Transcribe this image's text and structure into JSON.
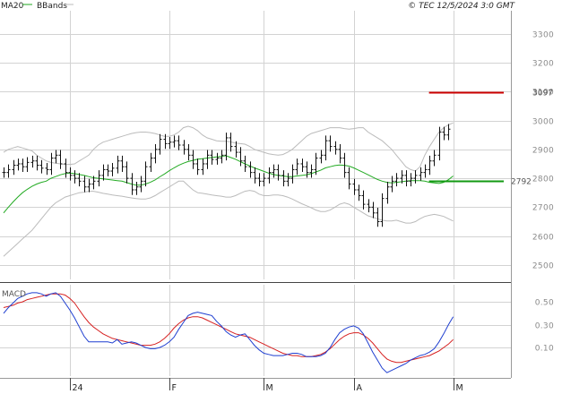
{
  "header": {
    "ma_label": "MA20",
    "bb_label": "BBands",
    "source": "© TEC 12/5/2024 3:0 GMT"
  },
  "colors": {
    "price": "#111111",
    "ma20": "#22aa22",
    "bbands": "#bbbbbb",
    "macd": "#1f3fd0",
    "signal": "#d62020",
    "grid": "#d3d3d3",
    "resistance": "#cc0000",
    "support": "#119911"
  },
  "chart_data": [
    {
      "type": "ohlc",
      "ylim": [
        2450,
        3380
      ],
      "yticks": [
        2500,
        2600,
        2700,
        2800,
        2900,
        3000,
        3100,
        3200,
        3300
      ],
      "ytick_labels": [
        "2500",
        "2600",
        "2700",
        "2800",
        "2900",
        "3000",
        "3100",
        "3200",
        "3300"
      ],
      "x_labels": [
        {
          "bar": 14,
          "label": "24"
        },
        {
          "bar": 35,
          "label": "F"
        },
        {
          "bar": 55,
          "label": "M"
        },
        {
          "bar": 74,
          "label": "A"
        },
        {
          "bar": 95,
          "label": "M"
        }
      ],
      "closes": [
        2820,
        2830,
        2845,
        2850,
        2840,
        2855,
        2860,
        2845,
        2835,
        2830,
        2870,
        2880,
        2850,
        2820,
        2810,
        2800,
        2790,
        2770,
        2780,
        2790,
        2810,
        2830,
        2825,
        2835,
        2860,
        2840,
        2800,
        2760,
        2770,
        2790,
        2840,
        2870,
        2900,
        2935,
        2920,
        2925,
        2930,
        2915,
        2900,
        2880,
        2850,
        2830,
        2850,
        2880,
        2865,
        2870,
        2880,
        2940,
        2910,
        2890,
        2860,
        2840,
        2820,
        2800,
        2790,
        2800,
        2820,
        2830,
        2810,
        2790,
        2800,
        2830,
        2850,
        2840,
        2820,
        2830,
        2870,
        2880,
        2930,
        2910,
        2900,
        2870,
        2820,
        2780,
        2760,
        2740,
        2710,
        2700,
        2680,
        2650,
        2730,
        2770,
        2790,
        2800,
        2810,
        2790,
        2800,
        2810,
        2820,
        2830,
        2860,
        2880,
        2960,
        2950,
        2970
      ],
      "bars": 96,
      "ma20": [
        2680,
        2700,
        2718,
        2735,
        2750,
        2762,
        2772,
        2780,
        2786,
        2790,
        2800,
        2806,
        2812,
        2816,
        2818,
        2816,
        2813,
        2810,
        2806,
        2802,
        2800,
        2798,
        2796,
        2794,
        2792,
        2790,
        2785,
        2780,
        2776,
        2776,
        2780,
        2786,
        2794,
        2805,
        2815,
        2826,
        2836,
        2845,
        2852,
        2858,
        2862,
        2866,
        2868,
        2870,
        2872,
        2874,
        2876,
        2878,
        2872,
        2866,
        2858,
        2850,
        2843,
        2836,
        2830,
        2824,
        2818,
        2813,
        2810,
        2808,
        2806,
        2806,
        2808,
        2810,
        2812,
        2816,
        2822,
        2828,
        2836,
        2840,
        2844,
        2846,
        2845,
        2842,
        2836,
        2828,
        2820,
        2812,
        2804,
        2796,
        2790,
        2786,
        2784,
        2786,
        2788,
        2790,
        2792,
        2792,
        2792,
        2790,
        2786,
        2784,
        2782,
        2786,
        2795,
        2808
      ],
      "bb_upper": [
        2890,
        2900,
        2905,
        2910,
        2905,
        2900,
        2895,
        2880,
        2870,
        2860,
        2855,
        2852,
        2850,
        2848,
        2848,
        2850,
        2860,
        2870,
        2880,
        2900,
        2915,
        2925,
        2930,
        2935,
        2940,
        2945,
        2950,
        2955,
        2958,
        2960,
        2960,
        2958,
        2955,
        2950,
        2945,
        2945,
        2950,
        2960,
        2975,
        2980,
        2975,
        2965,
        2950,
        2940,
        2935,
        2930,
        2928,
        2928,
        2926,
        2922,
        2920,
        2918,
        2910,
        2900,
        2895,
        2890,
        2885,
        2882,
        2880,
        2882,
        2890,
        2900,
        2915,
        2930,
        2945,
        2955,
        2960,
        2965,
        2970,
        2975,
        2975,
        2975,
        2972,
        2970,
        2972,
        2975,
        2975,
        2960,
        2950,
        2940,
        2930,
        2915,
        2900,
        2880,
        2860,
        2840,
        2830,
        2825,
        2840,
        2880,
        2910,
        2935,
        2960,
        2975,
        2985,
        2992
      ],
      "bb_lower": [
        2530,
        2545,
        2560,
        2575,
        2590,
        2605,
        2620,
        2640,
        2660,
        2680,
        2700,
        2715,
        2725,
        2735,
        2740,
        2745,
        2750,
        2752,
        2755,
        2755,
        2752,
        2748,
        2745,
        2742,
        2740,
        2738,
        2735,
        2732,
        2730,
        2728,
        2728,
        2732,
        2740,
        2750,
        2760,
        2770,
        2780,
        2790,
        2790,
        2775,
        2760,
        2750,
        2748,
        2745,
        2742,
        2740,
        2738,
        2735,
        2735,
        2740,
        2748,
        2755,
        2758,
        2755,
        2745,
        2740,
        2740,
        2742,
        2742,
        2740,
        2735,
        2728,
        2720,
        2712,
        2705,
        2698,
        2690,
        2685,
        2685,
        2690,
        2700,
        2710,
        2715,
        2710,
        2700,
        2690,
        2680,
        2670,
        2665,
        2660,
        2655,
        2652,
        2652,
        2655,
        2650,
        2645,
        2645,
        2650,
        2660,
        2668,
        2672,
        2675,
        2672,
        2668,
        2660,
        2652
      ],
      "resistance": {
        "value": 3097,
        "label": "3097",
        "start_bar": 88
      },
      "support": {
        "value": 2792,
        "label": "2792",
        "start_bar": 88
      }
    },
    {
      "type": "line",
      "title": "MACD",
      "ylim": [
        -0.15,
        0.65
      ],
      "yticks": [
        0.1,
        0.3,
        0.5
      ],
      "ytick_labels": [
        "0.10",
        "0.30",
        "0.50"
      ],
      "series": [
        {
          "name": "macd",
          "values": [
            0.4,
            0.45,
            0.49,
            0.53,
            0.55,
            0.57,
            0.58,
            0.58,
            0.57,
            0.55,
            0.57,
            0.58,
            0.55,
            0.49,
            0.43,
            0.36,
            0.28,
            0.2,
            0.15,
            0.15,
            0.15,
            0.15,
            0.15,
            0.14,
            0.17,
            0.13,
            0.14,
            0.15,
            0.14,
            0.12,
            0.1,
            0.09,
            0.09,
            0.1,
            0.12,
            0.15,
            0.19,
            0.26,
            0.32,
            0.38,
            0.4,
            0.41,
            0.4,
            0.39,
            0.38,
            0.33,
            0.29,
            0.24,
            0.21,
            0.19,
            0.21,
            0.22,
            0.17,
            0.12,
            0.08,
            0.05,
            0.04,
            0.03,
            0.03,
            0.03,
            0.04,
            0.05,
            0.05,
            0.04,
            0.02,
            0.02,
            0.02,
            0.03,
            0.05,
            0.1,
            0.17,
            0.23,
            0.26,
            0.28,
            0.29,
            0.27,
            0.22,
            0.14,
            0.06,
            -0.01,
            -0.08,
            -0.12,
            -0.1,
            -0.08,
            -0.06,
            -0.04,
            -0.01,
            0.01,
            0.03,
            0.04,
            0.06,
            0.09,
            0.15,
            0.22,
            0.3,
            0.37
          ]
        },
        {
          "name": "signal",
          "values": [
            0.45,
            0.46,
            0.47,
            0.49,
            0.5,
            0.52,
            0.53,
            0.54,
            0.55,
            0.56,
            0.57,
            0.57,
            0.57,
            0.56,
            0.53,
            0.49,
            0.43,
            0.37,
            0.32,
            0.28,
            0.25,
            0.22,
            0.2,
            0.18,
            0.17,
            0.16,
            0.15,
            0.14,
            0.13,
            0.12,
            0.12,
            0.12,
            0.13,
            0.15,
            0.18,
            0.22,
            0.27,
            0.31,
            0.34,
            0.36,
            0.37,
            0.37,
            0.36,
            0.34,
            0.32,
            0.3,
            0.28,
            0.26,
            0.24,
            0.22,
            0.21,
            0.2,
            0.19,
            0.17,
            0.15,
            0.13,
            0.11,
            0.09,
            0.07,
            0.05,
            0.04,
            0.03,
            0.03,
            0.02,
            0.02,
            0.02,
            0.03,
            0.04,
            0.06,
            0.09,
            0.13,
            0.17,
            0.2,
            0.22,
            0.23,
            0.23,
            0.21,
            0.18,
            0.14,
            0.09,
            0.04,
            0.0,
            -0.02,
            -0.03,
            -0.03,
            -0.02,
            -0.01,
            0.0,
            0.01,
            0.02,
            0.03,
            0.05,
            0.07,
            0.1,
            0.13,
            0.17
          ]
        }
      ]
    }
  ]
}
